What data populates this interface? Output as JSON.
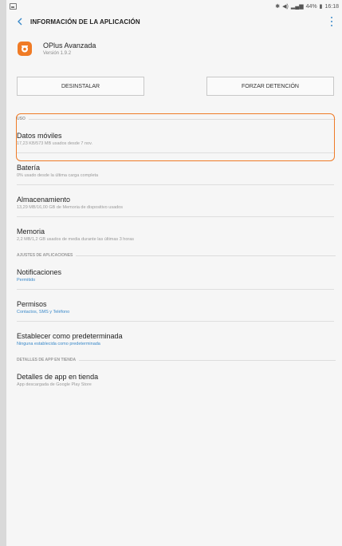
{
  "status_bar": {
    "time": "16:18",
    "battery": "44%"
  },
  "app_bar": {
    "title": "INFORMACIÓN DE LA APLICACIÓN"
  },
  "app": {
    "name": "OPlus Avanzada",
    "version": "Versión 1.9.2",
    "icon_color": "#f07b25"
  },
  "buttons": {
    "uninstall": "DESINSTALAR",
    "force_stop": "FORZAR DETENCIÓN"
  },
  "sections": {
    "usage": "USO",
    "app_settings": "AJUSTES DE APLICACIONES",
    "store_details": "DETALLES DE APP EN TIENDA"
  },
  "usage_items": [
    {
      "title": "Datos móviles",
      "subtitle": "17,23 KB/573 MB usados desde 7 nov."
    },
    {
      "title": "Batería",
      "subtitle": "0% usado desde la última carga completa"
    },
    {
      "title": "Almacenamiento",
      "subtitle": "13,29 MB/16,00 GB de Memoria de dispositivo usados"
    },
    {
      "title": "Memoria",
      "subtitle": "2,2 MB/1,2 GB usados de media durante las últimas 3 horas"
    }
  ],
  "settings_items": [
    {
      "title": "Notificaciones",
      "subtitle": "Permitido"
    },
    {
      "title": "Permisos",
      "subtitle": "Contactos, SMS y Teléfono"
    },
    {
      "title": "Establecer como predeterminada",
      "subtitle": "Ninguna establecida como predeterminada"
    }
  ],
  "store_items": [
    {
      "title": "Detalles de app en tienda",
      "subtitle": "App descargada de Google Play Store"
    }
  ],
  "colors": {
    "accent": "#3a89c9",
    "highlight": "#ef7b27"
  }
}
